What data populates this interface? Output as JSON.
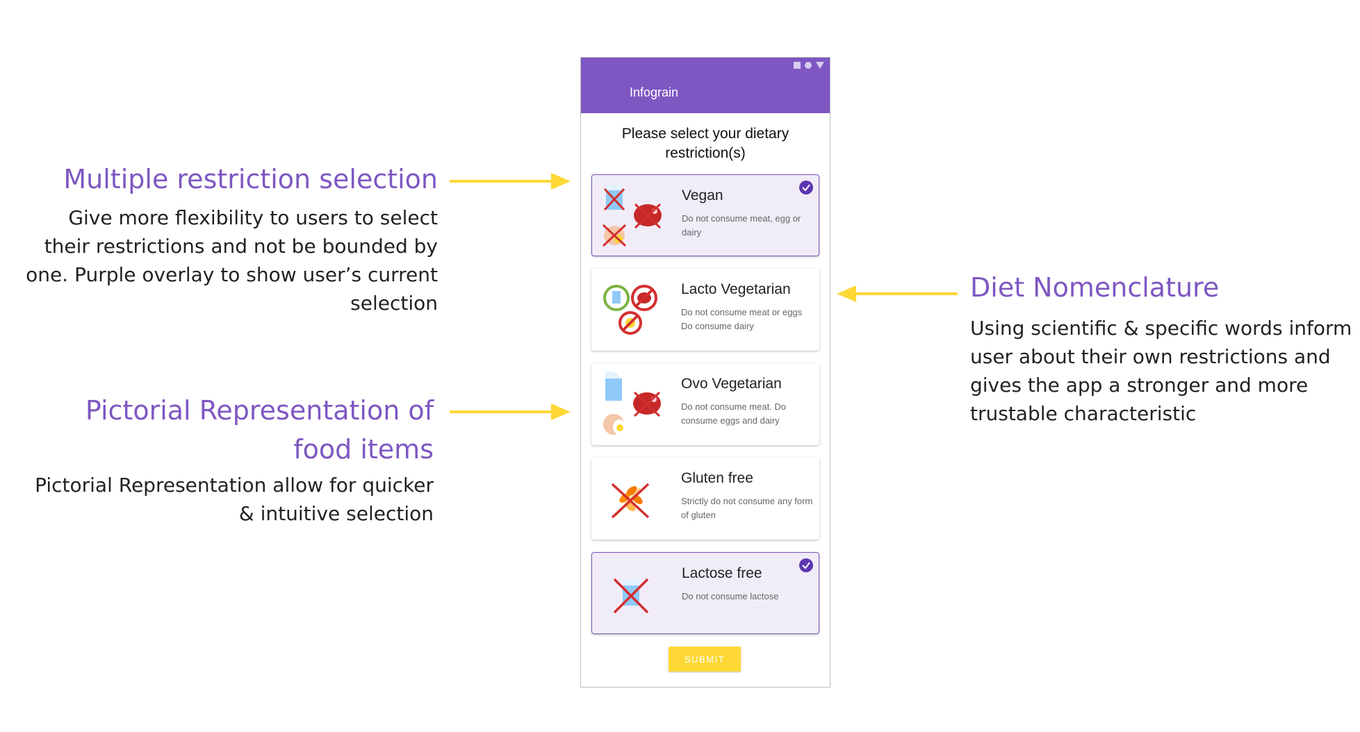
{
  "annotations": {
    "multiple": {
      "title": "Multiple restriction selection",
      "lines": [
        "Give more flexibility to users to select",
        "their restrictions and not be bounded by",
        "one. Purple overlay to show  user’s current",
        "selection"
      ]
    },
    "pictorial": {
      "title_lines": [
        "Pictorial Representation of",
        "food items"
      ],
      "lines": [
        "Pictorial Representation allow for quicker",
        "& intuitive selection"
      ]
    },
    "nomenclature": {
      "title": "Diet Nomenclature",
      "lines": [
        "Using scientific & specific words inform",
        "user about their own restrictions and",
        "gives the app a stronger and more",
        "trustable characteristic"
      ]
    }
  },
  "app": {
    "title": "Infograin",
    "prompt_lines": [
      "Please select your dietary",
      "restriction(s)"
    ],
    "options": [
      {
        "title": "Vegan",
        "desc": "Do not consume meat, egg or dairy",
        "selected": true,
        "icons": [
          "milk-crossed-icon",
          "meat-crossed-icon",
          "egg-crossed-icon"
        ]
      },
      {
        "title": "Lacto Vegetarian",
        "desc": "Do not consume meat or eggs Do consume dairy",
        "selected": false,
        "icons": [
          "milk-allowed-icon",
          "meat-forbidden-icon",
          "egg-forbidden-icon"
        ]
      },
      {
        "title": "Ovo Vegetarian",
        "desc": "Do not consume meat. Do consume eggs and dairy",
        "selected": false,
        "icons": [
          "milk-icon",
          "meat-crossed-icon",
          "egg-icon"
        ]
      },
      {
        "title": "Gluten free",
        "desc": "Strictly do not consume any form of gluten",
        "selected": false,
        "icons": [
          "wheat-crossed-icon"
        ]
      },
      {
        "title": "Lactose free",
        "desc": "Do not consume lactose",
        "selected": true,
        "icons": [
          "milk-crossed-icon"
        ]
      }
    ],
    "submit_label": "SUBMIT"
  },
  "colors": {
    "accent": "#7e57c2",
    "arrow": "#fdd835",
    "selected_bg": "#f1edf8",
    "forbidden": "#d32f2f",
    "allowed": "#7cb342"
  }
}
